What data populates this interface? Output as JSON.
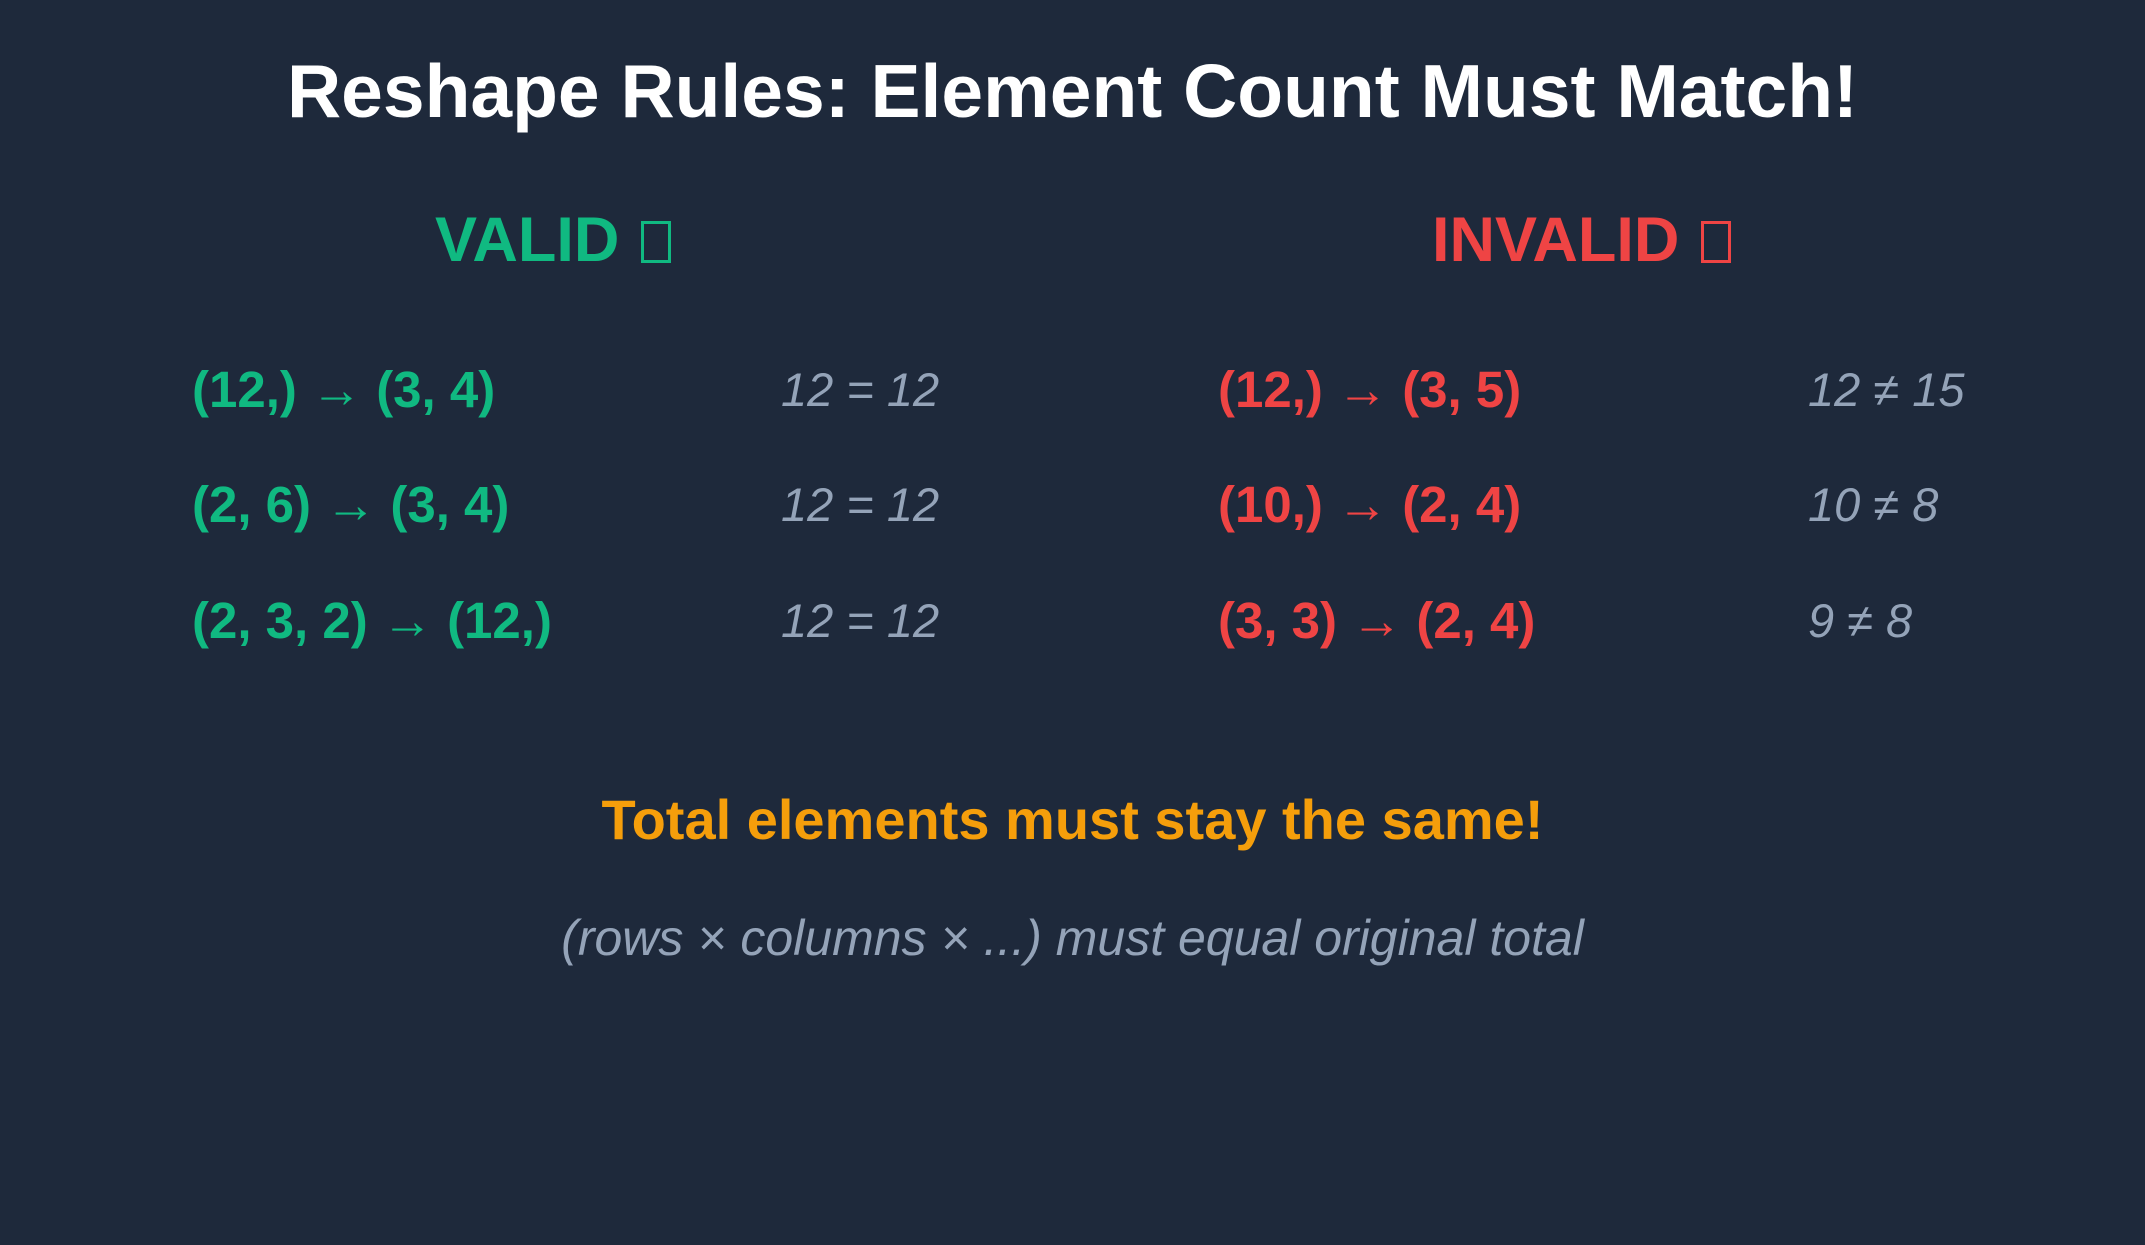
{
  "title": "Reshape Rules: Element Count Must Match!",
  "valid": {
    "heading": "VALID",
    "heading_icon": "unrendered-glyph-box",
    "color": "#10b981",
    "rows": [
      {
        "expr": "(12,) → (3, 4)",
        "check": "12 = 12"
      },
      {
        "expr": "(2, 6) → (3, 4)",
        "check": "12 = 12"
      },
      {
        "expr": "(2, 3, 2) → (12,)",
        "check": "12 = 12"
      }
    ]
  },
  "invalid": {
    "heading": "INVALID",
    "heading_icon": "unrendered-glyph-box",
    "color": "#ef4444",
    "rows": [
      {
        "expr": "(12,) → (3, 5)",
        "check": "12 ≠ 15"
      },
      {
        "expr": "(10,) → (2, 4)",
        "check": "10 ≠ 8"
      },
      {
        "expr": "(3, 3) → (2, 4)",
        "check": "9 ≠ 8"
      }
    ]
  },
  "rule": "Total elements must stay the same!",
  "note": "(rows × columns × ...) must equal original total",
  "colors": {
    "background": "#1e293b",
    "rule": "#f59e0b",
    "muted": "#94a3b8"
  }
}
